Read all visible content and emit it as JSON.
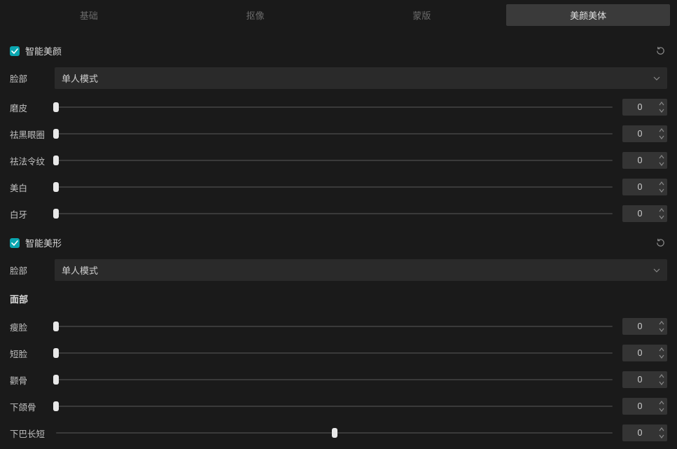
{
  "tabs": [
    {
      "label": "基础",
      "active": false
    },
    {
      "label": "抠像",
      "active": false
    },
    {
      "label": "蒙版",
      "active": false
    },
    {
      "label": "美颜美体",
      "active": true
    }
  ],
  "sectionA": {
    "checked": true,
    "title": "智能美颜",
    "faceLabel": "脸部",
    "faceMode": "单人模式",
    "sliders": [
      {
        "label": "磨皮",
        "value": 0,
        "pos": 0
      },
      {
        "label": "祛黑眼圈",
        "value": 0,
        "pos": 0
      },
      {
        "label": "祛法令纹",
        "value": 0,
        "pos": 0
      },
      {
        "label": "美白",
        "value": 0,
        "pos": 0
      },
      {
        "label": "白牙",
        "value": 0,
        "pos": 0
      }
    ]
  },
  "sectionB": {
    "checked": true,
    "title": "智能美形",
    "faceLabel": "脸部",
    "faceMode": "单人模式",
    "subheading": "面部",
    "sliders": [
      {
        "label": "瘦脸",
        "value": 0,
        "pos": 0
      },
      {
        "label": "短脸",
        "value": 0,
        "pos": 0
      },
      {
        "label": "颧骨",
        "value": 0,
        "pos": 0
      },
      {
        "label": "下颌骨",
        "value": 0,
        "pos": 0
      },
      {
        "label": "下巴长短",
        "value": 0,
        "pos": 50
      }
    ]
  }
}
